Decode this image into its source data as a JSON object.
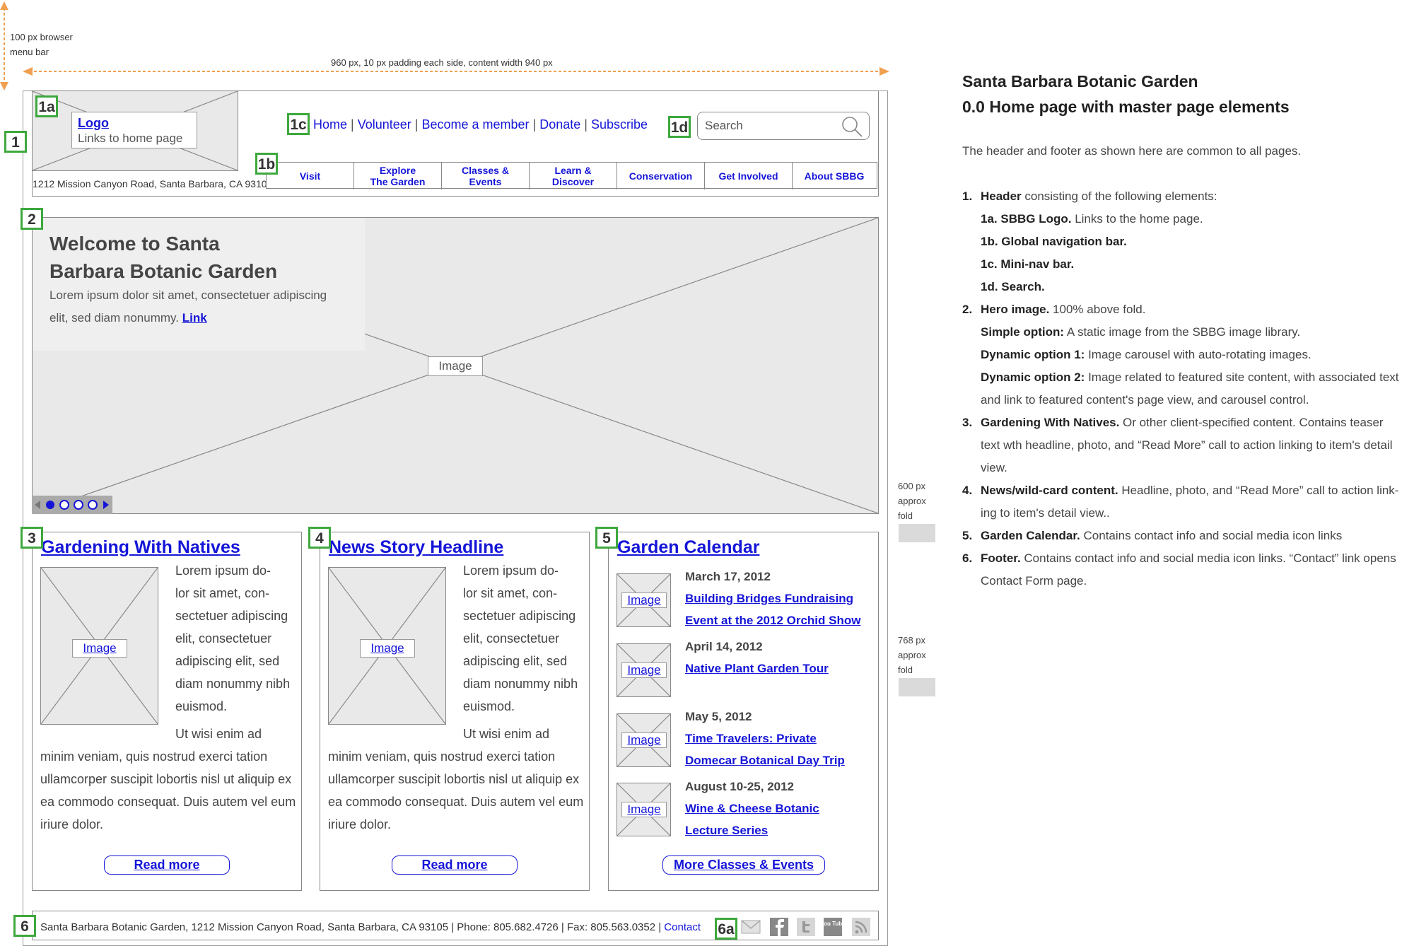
{
  "annotations": {
    "browser_bar": [
      "100 px browser",
      "menu bar"
    ],
    "width_note": "960 px, 10 px padding each side, content width 940 px",
    "fold_600": [
      "600 px",
      "approx",
      "fold"
    ],
    "fold_768": [
      "768 px",
      "approx",
      "fold"
    ],
    "tags": {
      "t1": "1",
      "t1a": "1a",
      "t1b": "1b",
      "t1c": "1c",
      "t1d": "1d",
      "t2": "2",
      "t3": "3",
      "t4": "4",
      "t5": "5",
      "t6": "6",
      "t6a": "6a"
    }
  },
  "header": {
    "logo_link": "Logo",
    "logo_sub": "Links to home page",
    "address": "1212 Mission Canyon Road, Santa Barbara, CA 93105",
    "mini_nav": [
      "Home",
      "Volunteer",
      "Become a member",
      "Donate",
      "Subscribe"
    ],
    "search_placeholder": "Search",
    "global_nav": [
      [
        "Visit"
      ],
      [
        "Explore",
        "The Garden"
      ],
      [
        "Classes &",
        "Events"
      ],
      [
        "Learn &",
        "Discover"
      ],
      [
        "Conservation"
      ],
      [
        "Get Involved"
      ],
      [
        "About SBBG"
      ]
    ]
  },
  "hero": {
    "title_line1": "Welcome to Santa",
    "title_line2": "Barbara Botanic Garden",
    "text_line1": "Lorem ipsum dolor sit amet, consectetuer adipiscing",
    "text_line2": "elit, sed diam nonummy.",
    "link": "Link",
    "image_label": "Image",
    "carousel": {
      "active": 1,
      "dots": 4
    }
  },
  "col_natives": {
    "title": "Gardening With Natives",
    "image_label": "Image",
    "side_text": [
      "Lorem ipsum do-",
      "lor sit amet, con-",
      "sectetuer adipiscing",
      "elit, consectetuer",
      "adipiscing elit, sed",
      "diam nonummy nibh",
      "euismod."
    ],
    "wrap_text": [
      "Ut wisi enim ad",
      "minim veniam, quis nostrud  exerci tation",
      "ullamcorper suscipit lobortis nisl ut aliquip ex",
      "ea commodo consequat. Duis autem vel eum",
      "iriure dolor."
    ],
    "button": "Read more"
  },
  "col_news": {
    "title": "News Story Headline",
    "image_label": "Image",
    "side_text": [
      "Lorem ipsum do-",
      "lor sit amet, con-",
      "sectetuer adipiscing",
      "elit, consectetuer",
      "adipiscing elit, sed",
      "diam nonummy nibh",
      "euismod."
    ],
    "wrap_text": [
      "Ut wisi enim ad",
      "minim veniam, quis nostrud  exerci tation",
      "ullamcorper suscipit lobortis nisl ut aliquip ex",
      "ea commodo consequat. Duis autem vel eum",
      "iriure dolor."
    ],
    "button": "Read more"
  },
  "calendar": {
    "title": "Garden Calendar",
    "events": [
      {
        "date": "March 17, 2012",
        "title": [
          "Building Bridges Fundraising",
          "Event at the 2012 Orchid Show"
        ],
        "image_label": "Image"
      },
      {
        "date": "April 14, 2012",
        "title": [
          "Native Plant Garden Tour"
        ],
        "image_label": "Image"
      },
      {
        "date": "May 5, 2012",
        "title": [
          "Time Travelers: Private",
          "Domecar Botanical Day Trip"
        ],
        "image_label": "Image"
      },
      {
        "date": "August 10-25, 2012",
        "title": [
          "Wine & Cheese Botanic",
          "Lecture Series"
        ],
        "image_label": "Image"
      }
    ],
    "button": "More Classes & Events"
  },
  "footer": {
    "text": "Santa Barbara Botanic Garden, 1212 Mission Canyon Road, Santa Barbara, CA 93105 | Phone: 805.682.4726 | Fax: 805.563.0352 |",
    "contact_link": "Contact",
    "social_icons": [
      "email-icon",
      "facebook-icon",
      "twitter-icon",
      "youtube-icon",
      "rss-icon"
    ],
    "youtube_glyph": "You Tube"
  },
  "notes": {
    "title_line1": "Santa Barbara Botanic Garden",
    "title_line2": "0.0 Home page with master page elements",
    "intro": "The header and footer as shown here are common to all pages.",
    "items": [
      {
        "num": "1.",
        "bold": "Header",
        "text": " consisting of the following elements:"
      },
      {
        "num": "",
        "bold": "1a. SBBG Logo.",
        "text": " Links to the home page."
      },
      {
        "num": "",
        "bold": "1b. Global navigation bar.",
        "text": ""
      },
      {
        "num": "",
        "bold": "1c. Mini-nav bar.",
        "text": ""
      },
      {
        "num": "",
        "bold": "1d. Search.",
        "text": ""
      },
      {
        "num": "2.",
        "bold": "Hero image.",
        "text": " 100% above fold."
      },
      {
        "num": "",
        "bold": "Simple option:",
        "text": " A static image from the SBBG image library."
      },
      {
        "num": "",
        "bold": "Dynamic option 1:",
        "text": " Image carousel with auto-rotating images."
      },
      {
        "num": "",
        "bold": "Dynamic option 2:",
        "text": " Image related to featured site content, with associated text"
      },
      {
        "num": "",
        "bold": "",
        "text": "and link to featured content's page view, and carousel control."
      },
      {
        "num": "3.",
        "bold": "Gardening With Natives.",
        "text": " Or other client-specified content. Contains teaser"
      },
      {
        "num": "",
        "bold": "",
        "text": "text wth headline, photo, and “Read More” call to action linking to item's detail"
      },
      {
        "num": "",
        "bold": "",
        "text": "view."
      },
      {
        "num": "4.",
        "bold": "News/wild-card content.",
        "text": " Headline, photo, and “Read More” call to action link-"
      },
      {
        "num": "",
        "bold": "",
        "text": "ing to item's detail view.."
      },
      {
        "num": "5.",
        "bold": "Garden Calendar.",
        "text": " Contains contact info and social media icon links"
      },
      {
        "num": "6.",
        "bold": "Footer.",
        "text": " Contains contact info and social media icon links. “Contact” link opens"
      },
      {
        "num": "",
        "bold": "",
        "text": "Contact Form page."
      }
    ]
  }
}
